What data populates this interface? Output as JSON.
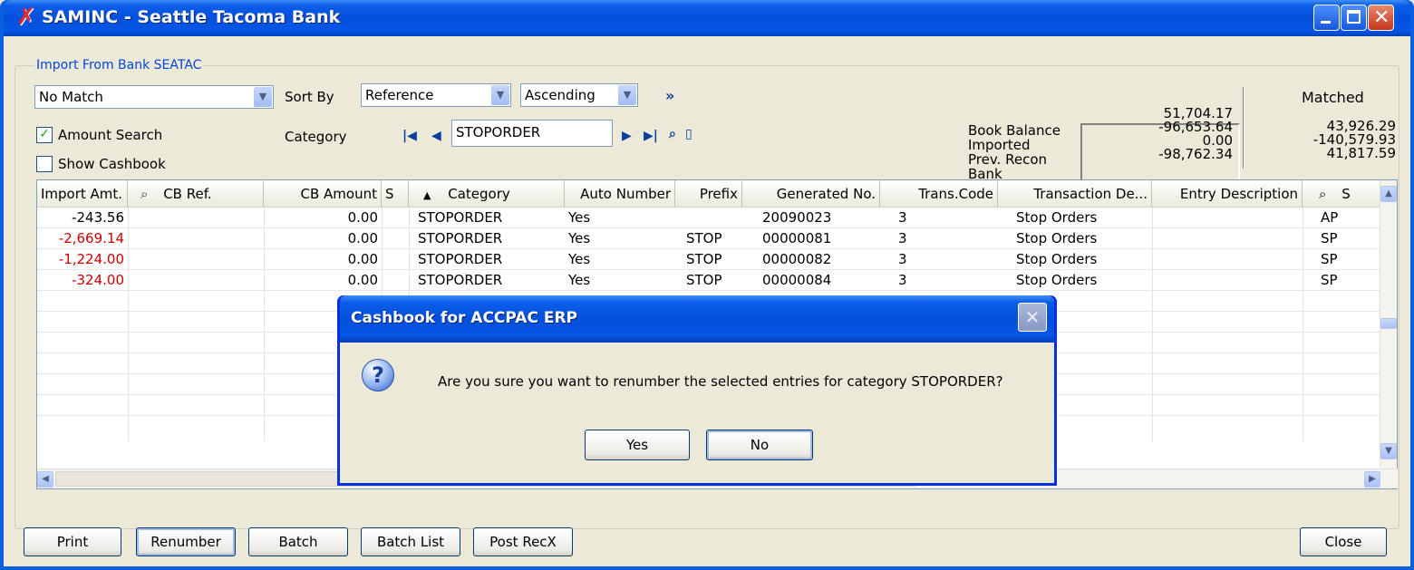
{
  "window": {
    "title": "SAMINC - Seattle Tacoma Bank"
  },
  "group": {
    "label": "Import From Bank SEATAC"
  },
  "filters": {
    "match_value": "No Match",
    "sort_by_label": "Sort By",
    "sort_field": "Reference",
    "sort_order": "Ascending",
    "amount_search_label": "Amount Search",
    "amount_search_checked": true,
    "show_cashbook_label": "Show Cashbook",
    "show_cashbook_checked": false,
    "category_label": "Category",
    "category_value": "STOPORDER"
  },
  "balances": {
    "labels": [
      "Book Balance",
      "Imported",
      "Prev. Recon",
      "Bank"
    ],
    "values": [
      "51,704.17",
      "-96,653.64",
      "0.00",
      "-98,762.34"
    ],
    "matched_title": "Matched",
    "matched_values": [
      "43,926.29",
      "-140,579.93",
      "41,817.59"
    ]
  },
  "grid": {
    "columns": [
      "Import Amt.",
      "CB Ref.",
      "CB Amount",
      "S",
      "Category",
      "Auto Number",
      "Prefix",
      "Generated No.",
      "Trans.Code",
      "Transaction De...",
      "Entry Description",
      "S"
    ],
    "rows": [
      {
        "import_amt": "-243.56",
        "cb_ref": "",
        "cb_amount": "0.00",
        "s": "",
        "category": "STOPORDER",
        "auto_number": "Yes",
        "prefix": "",
        "generated_no": "20090023",
        "trans_code": "3",
        "transaction_desc": "Stop Orders",
        "entry_desc": "",
        "last": "AP"
      },
      {
        "import_amt": "-2,669.14",
        "cb_ref": "",
        "cb_amount": "0.00",
        "s": "",
        "category": "STOPORDER",
        "auto_number": "Yes",
        "prefix": "STOP",
        "generated_no": "00000081",
        "trans_code": "3",
        "transaction_desc": "Stop Orders",
        "entry_desc": "",
        "last": "SP"
      },
      {
        "import_amt": "-1,224.00",
        "cb_ref": "",
        "cb_amount": "0.00",
        "s": "",
        "category": "STOPORDER",
        "auto_number": "Yes",
        "prefix": "STOP",
        "generated_no": "00000082",
        "trans_code": "3",
        "transaction_desc": "Stop Orders",
        "entry_desc": "",
        "last": "SP"
      },
      {
        "import_amt": "-324.00",
        "cb_ref": "",
        "cb_amount": "0.00",
        "s": "",
        "category": "STOPORDER",
        "auto_number": "Yes",
        "prefix": "STOP",
        "generated_no": "00000084",
        "trans_code": "3",
        "transaction_desc": "Stop Orders",
        "entry_desc": "",
        "last": "SP"
      }
    ],
    "negative_color": "#cc0000"
  },
  "buttons": {
    "print": "Print",
    "renumber": "Renumber",
    "batch": "Batch",
    "batch_list": "Batch List",
    "post_recx": "Post RecX",
    "close": "Close"
  },
  "dialog": {
    "title": "Cashbook for ACCPAC ERP",
    "message": "Are you sure you want to renumber the selected entries for category STOPORDER?",
    "yes_label": "Yes",
    "no_label": "No",
    "icon": "question-icon"
  }
}
